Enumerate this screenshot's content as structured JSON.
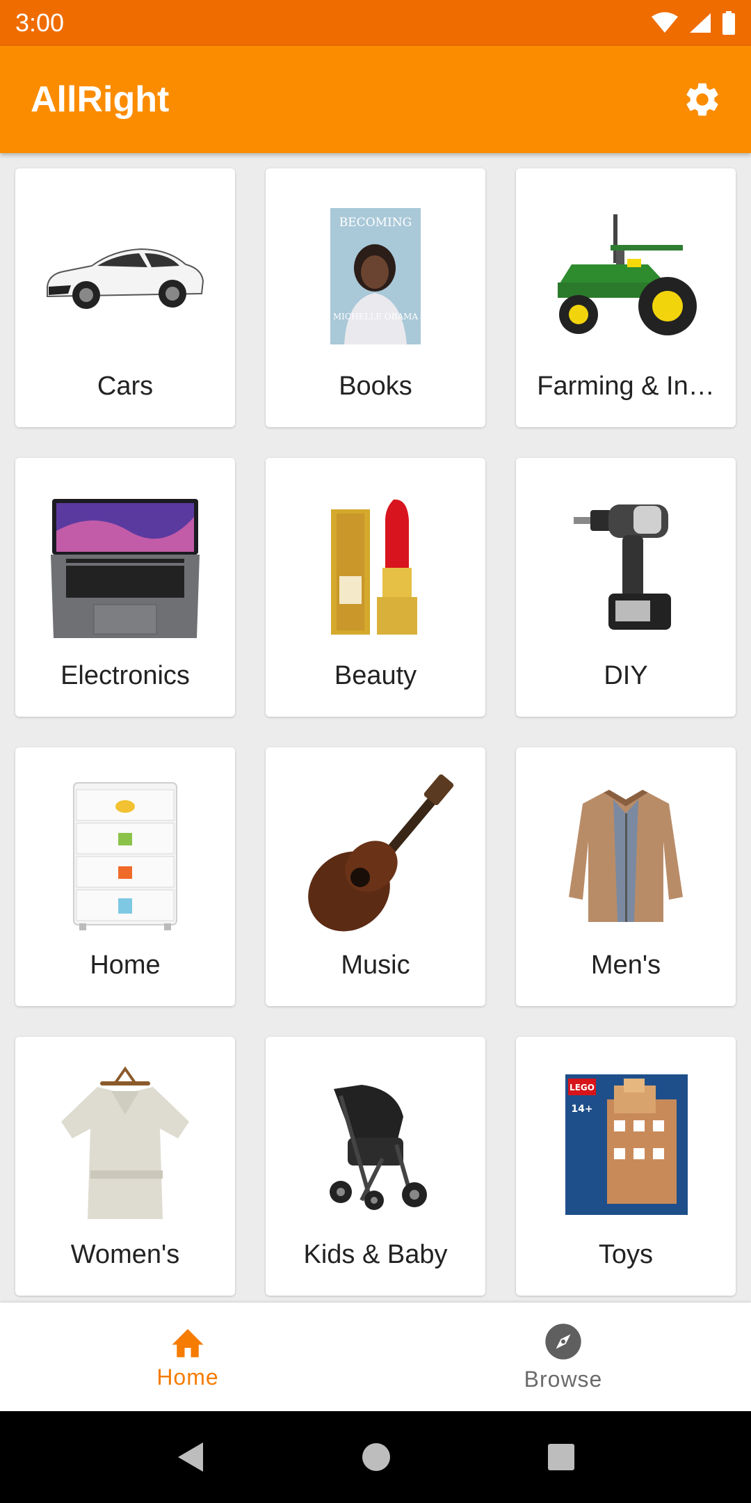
{
  "status": {
    "time": "3:00",
    "icons": [
      "wifi-icon",
      "signal-icon",
      "battery-icon"
    ]
  },
  "app": {
    "title": "AllRight",
    "settings_icon": "gear-icon",
    "accent": "#fb8c00",
    "status_bar_color": "#ef6c00"
  },
  "categories": [
    {
      "label": "Cars",
      "icon": "car-image"
    },
    {
      "label": "Books",
      "icon": "book-image"
    },
    {
      "label": "Farming & In…",
      "icon": "tractor-image"
    },
    {
      "label": "Electronics",
      "icon": "laptop-image"
    },
    {
      "label": "Beauty",
      "icon": "lipstick-image"
    },
    {
      "label": "DIY",
      "icon": "drill-image"
    },
    {
      "label": "Home",
      "icon": "dresser-image"
    },
    {
      "label": "Music",
      "icon": "guitar-image"
    },
    {
      "label": "Men's",
      "icon": "jacket-image"
    },
    {
      "label": "Women's",
      "icon": "blouse-image"
    },
    {
      "label": "Kids & Baby",
      "icon": "stroller-image"
    },
    {
      "label": "Toys",
      "icon": "lego-box-image"
    }
  ],
  "images": {
    "book_title": "BECOMING",
    "book_author": "MICHELLE OBAMA",
    "lego_brand": "LEGO",
    "lego_age": "14+"
  },
  "bottom_nav": {
    "home_label": "Home",
    "browse_label": "Browse",
    "active": "Home",
    "active_color": "#f57c00"
  }
}
